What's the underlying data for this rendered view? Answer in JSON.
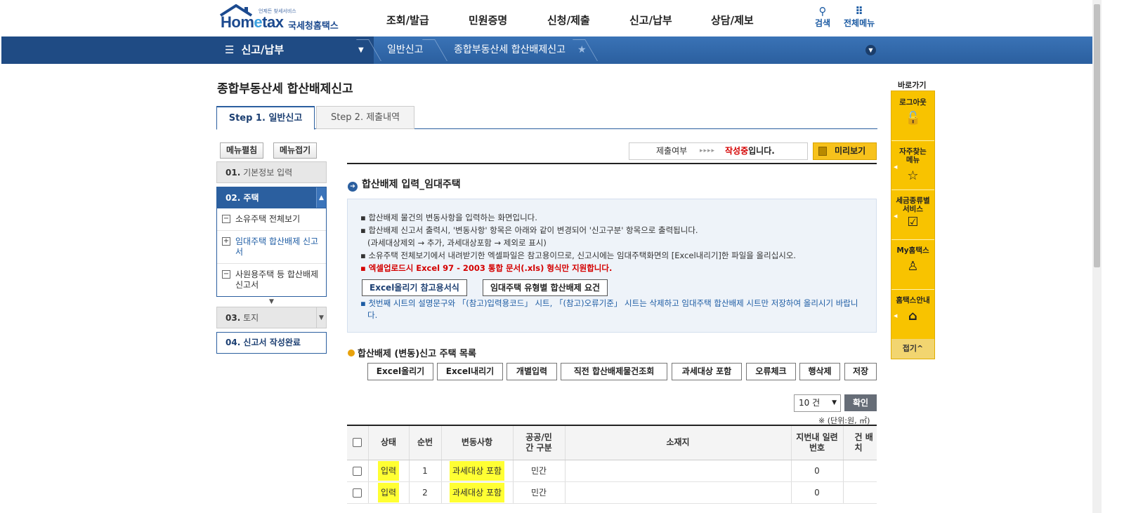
{
  "header": {
    "logo_sub": "언제든 찾세서비스",
    "logo_brand_a": "Hom",
    "logo_brand_e": "e",
    "logo_brand_b": "tax",
    "logo_kname": "국세청홈택스",
    "gnb": [
      "조회/발급",
      "민원증명",
      "신청/제출",
      "신고/납부",
      "상담/제보"
    ],
    "search_label": "검색",
    "allmenu_label": "전체메뉴"
  },
  "nav": {
    "menu_label": "신고/납부",
    "crumb1": "일반신고",
    "crumb2": "종합부동산세 합산배제신고"
  },
  "page": {
    "title": "종합부동산세 합산배제신고",
    "tabs": [
      "Step 1. 일반신고",
      "Step 2. 제출내역"
    ]
  },
  "left": {
    "expand_label": "메뉴펼침",
    "collapse_label": "메뉴접기",
    "step1_num": "01.",
    "step1_label": "기본정보 입력",
    "step2_num": "02.",
    "step2_label": "주택",
    "sub_items": [
      "소유주택 전체보기",
      "임대주택 합산배제 신고서",
      "사원용주택 등 합산배제 신고서"
    ],
    "step3_num": "03.",
    "step3_label": "토지",
    "step4_label": "04. 신고서 작성완료"
  },
  "status": {
    "label": "제출여부",
    "arrows": "▸▸▸▸",
    "value": "작성중",
    "tail": "입니다.",
    "preview_label": "미리보기"
  },
  "section": {
    "title": "합산배제 입력_임대주택",
    "lines": [
      "▪ 합산배제 물건의 변동사항을 입력하는 화면입니다.",
      "▪ 합산배제 신고서 출력시, '변동사항' 항목은 아래와 같이 변경되어 '신고구분' 항목으로 출력됩니다.",
      "(과세대상제외 → 추가, 과세대상포함 → 제외로 표시)",
      "▪ 소유주택 전체보기에서 내려받기한 엑셀파일은 참고용이므로, 신고시에는 임대주택화면의 [Excel내리기]한 파일을 올리십시오.",
      "▪ 엑셀업로드시 Excel 97 - 2003 통합 문서(.xls) 형식만 지원합니다."
    ],
    "btn_excel_form": "Excel올리기 참고용서식",
    "btn_requirements": "임대주택 유형별 합산배제 요건",
    "note_line1": "▪ 첫번째 시트의 설명문구와 「(참고)입력용코드」 시트, 「(참고)오류기준」 시트는 삭제하고 임대주택 합산배제 시트만 저장하여 올리시기 바랍니",
    "note_line2": "다."
  },
  "list": {
    "title": "합산배제 (변동)신고 주택 목록",
    "actions": [
      "Excel올리기",
      "Excel내리기",
      "개별입력",
      "직전 합산배제물건조회",
      "과세대상 포함",
      "오류체크",
      "행삭제",
      "저장"
    ],
    "page_size": "10 건",
    "confirm": "확인",
    "unit": "※ (단위:원, ㎡)",
    "columns": [
      "상태",
      "순번",
      "변동사항",
      "공공/민간 구분",
      "소재지",
      "지번내 일련번호",
      "건 배치"
    ],
    "rows": [
      {
        "status": "입력",
        "seq": "1",
        "change": "과세대상 포함",
        "type": "민간",
        "addr": "",
        "serial": "0"
      },
      {
        "status": "입력",
        "seq": "2",
        "change": "과세대상 포함",
        "type": "민간",
        "addr": "",
        "serial": "0"
      }
    ]
  },
  "quickbar": {
    "title": "바로가기",
    "items": [
      "로그아웃",
      "자주찾는 메뉴",
      "세금종류별 서비스",
      "My홈택스",
      "홈택스안내"
    ],
    "fold": "접기^"
  },
  "colors": {
    "primary": "#2b5f9f",
    "accent_yellow": "#f8c300",
    "highlight": "#ffff33",
    "alert_red": "#d40000"
  }
}
